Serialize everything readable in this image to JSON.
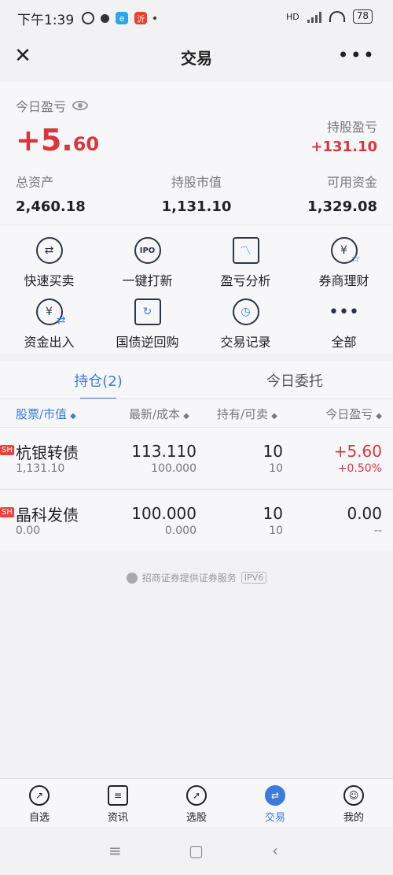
{
  "status_bar": {
    "time": "下午1:39",
    "app2_label": "沂",
    "network": "HD",
    "battery": "78"
  },
  "nav": {
    "title": "交易"
  },
  "account": {
    "today_pl_label": "今日盈亏",
    "today_pl_int": "+5.",
    "today_pl_dec": "60",
    "holding_pl_label": "持股盈亏",
    "holding_pl_value": "+131.10",
    "total_assets_label": "总资产",
    "total_assets_value": "2,460.18",
    "market_value_label": "持股市值",
    "market_value_value": "1,131.10",
    "available_label": "可用资金",
    "available_value": "1,329.08"
  },
  "functions": [
    {
      "label": "快速买卖",
      "icon": "swap-icon"
    },
    {
      "label": "一键打新",
      "icon": "ipo-icon"
    },
    {
      "label": "盈亏分析",
      "icon": "chart-icon"
    },
    {
      "label": "券商理财",
      "icon": "yuan-star-icon"
    },
    {
      "label": "资金出入",
      "icon": "yuan-transfer-icon"
    },
    {
      "label": "国债逆回购",
      "icon": "repo-icon"
    },
    {
      "label": "交易记录",
      "icon": "clock-icon"
    },
    {
      "label": "全部",
      "icon": "more-icon"
    }
  ],
  "holdings": {
    "tab_active": "持仓(2)",
    "tab_inactive": "今日委托",
    "headers": [
      "股票/市值",
      "最新/成本",
      "持有/可卖",
      "今日盈亏"
    ],
    "rows": [
      {
        "market": "SH",
        "name": "杭银转债",
        "value": "1,131.10",
        "latest": "113.110",
        "cost": "100.000",
        "hold": "10",
        "sellable": "10",
        "pl": "+5.60",
        "pl_pct": "+0.50%"
      },
      {
        "market": "SH",
        "name": "晶科发债",
        "value": "0.00",
        "latest": "100.000",
        "cost": "0.000",
        "hold": "10",
        "sellable": "10",
        "pl": "0.00",
        "pl_pct": "--"
      }
    ]
  },
  "footer": {
    "note": "招商证券提供证券服务",
    "tag": "IPV6"
  },
  "tabbar": [
    {
      "label": "自选",
      "icon": "trend-icon"
    },
    {
      "label": "资讯",
      "icon": "news-icon"
    },
    {
      "label": "选股",
      "icon": "rocket-icon"
    },
    {
      "label": "交易",
      "icon": "exchange-icon"
    },
    {
      "label": "我的",
      "icon": "user-icon"
    }
  ],
  "colors": {
    "accent": "#3a7be0",
    "up": "#d9363e"
  }
}
